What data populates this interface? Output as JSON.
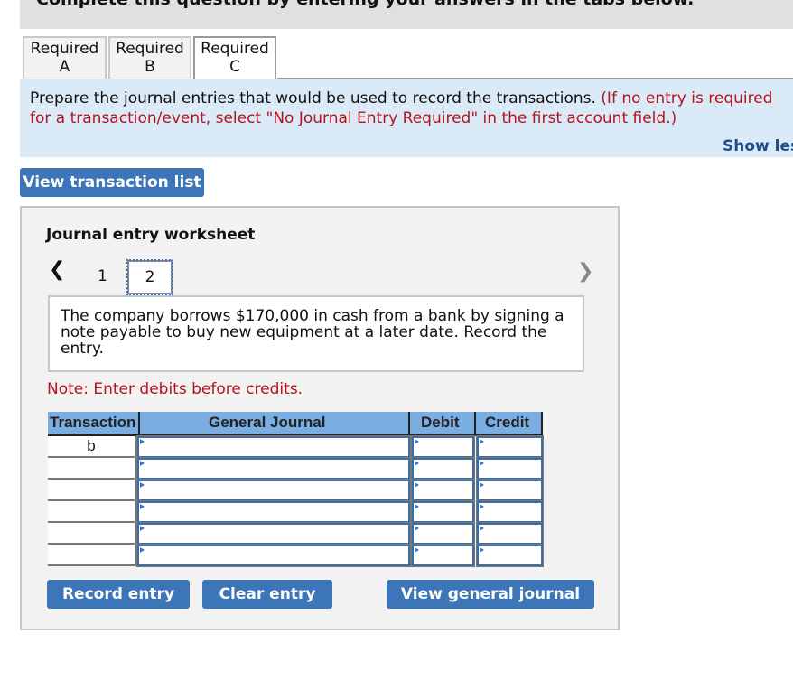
{
  "banner": {
    "text": "Complete this question by entering your answers in the tabs below."
  },
  "tabs": [
    {
      "line1": "Required",
      "line2": "A",
      "active": false
    },
    {
      "line1": "Required",
      "line2": "B",
      "active": false
    },
    {
      "line1": "Required",
      "line2": "C",
      "active": true
    }
  ],
  "instructions": {
    "main": "Prepare the journal entries that would be used to record the transactions. ",
    "red_line1": "(If no entry is required",
    "red_line2": "for a transaction/event, select \"No Journal Entry Required\" in the first account field.)",
    "show_less": "Show less"
  },
  "buttons": {
    "view_transaction_list": "View transaction list",
    "record_entry": "Record entry",
    "clear_entry": "Clear entry",
    "view_general_journal": "View general journal"
  },
  "worksheet": {
    "title": "Journal entry worksheet",
    "pages": [
      "1",
      "2"
    ],
    "current_page": "2",
    "prev_icon": "chevron-left-icon",
    "next_icon": "chevron-right-icon",
    "description": "The company borrows $170,000 in cash from a bank by signing a note payable to buy new equipment at a later date. Record the entry.",
    "note": "Note: Enter debits before credits.",
    "table": {
      "headers": {
        "transaction": "Transaction",
        "general_journal": "General Journal",
        "debit": "Debit",
        "credit": "Credit"
      },
      "rows": [
        {
          "transaction": "b",
          "account": "",
          "debit": "",
          "credit": ""
        },
        {
          "transaction": "",
          "account": "",
          "debit": "",
          "credit": ""
        },
        {
          "transaction": "",
          "account": "",
          "debit": "",
          "credit": ""
        },
        {
          "transaction": "",
          "account": "",
          "debit": "",
          "credit": ""
        },
        {
          "transaction": "",
          "account": "",
          "debit": "",
          "credit": ""
        },
        {
          "transaction": "",
          "account": "",
          "debit": "",
          "credit": ""
        }
      ]
    }
  }
}
